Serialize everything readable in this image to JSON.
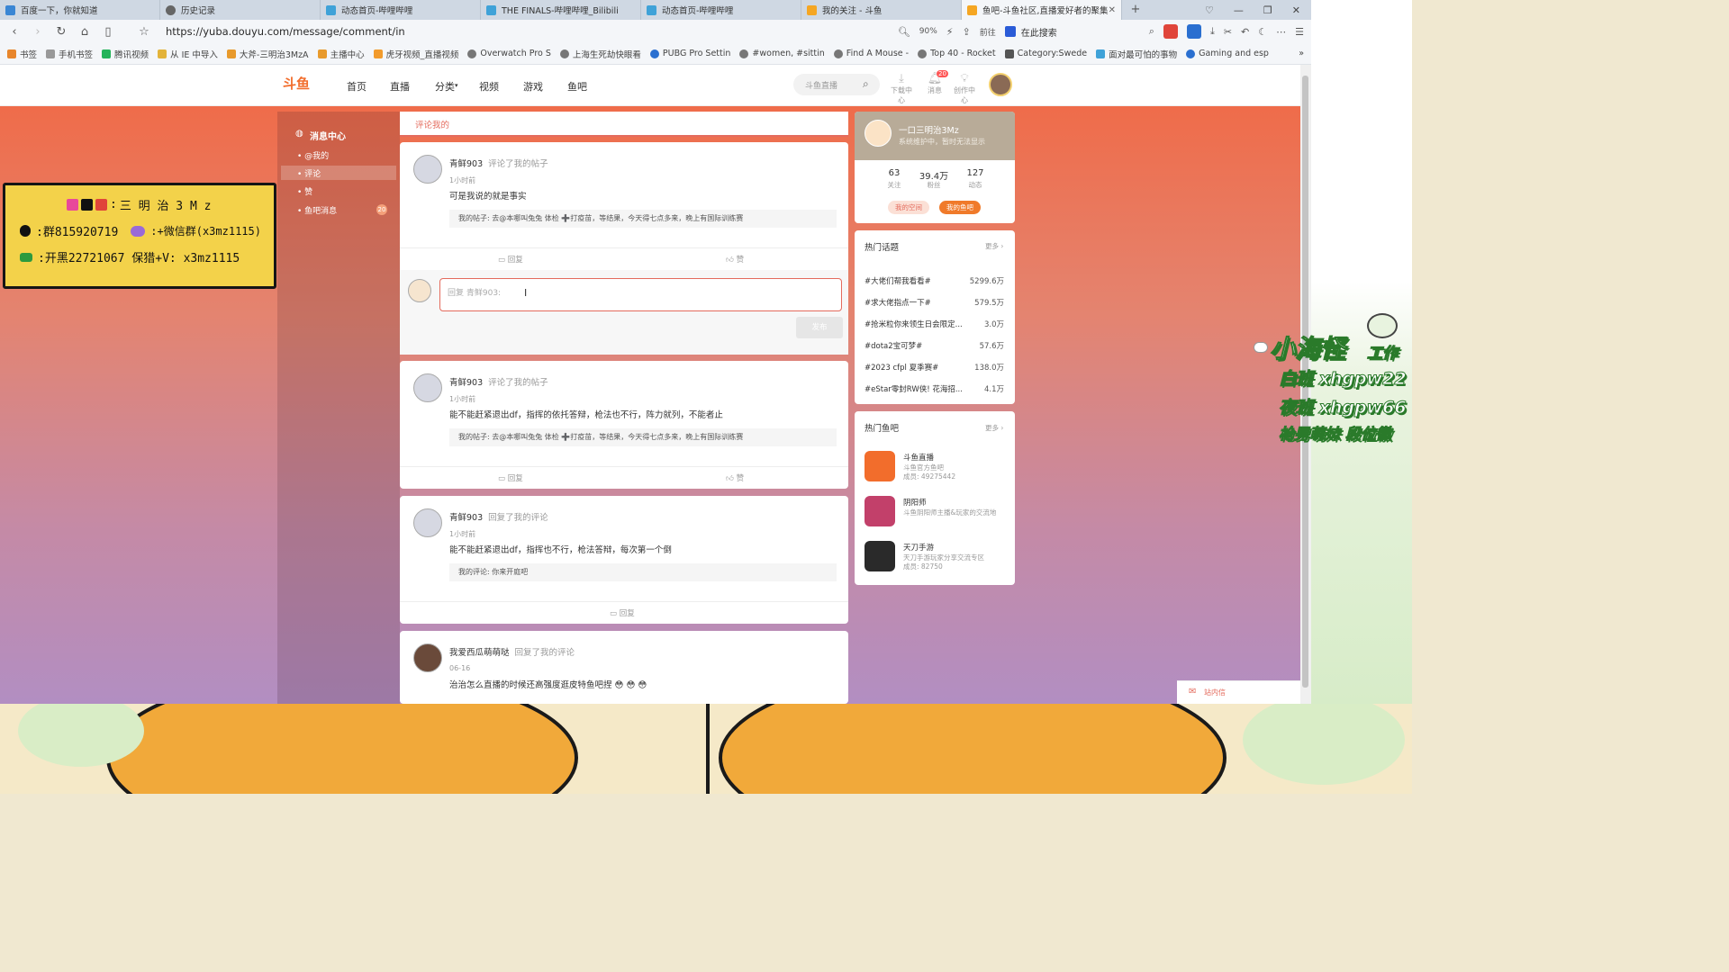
{
  "browser": {
    "tabs": [
      "百度一下，你就知道",
      "历史记录",
      "动态首页-哔哩哔哩",
      "THE FINALS-哔哩哔哩_Bilibili",
      "动态首页-哔哩哔哩",
      "我的关注 - 斗鱼",
      "鱼吧-斗鱼社区,直播爱好者的聚集"
    ],
    "new_tab": "+",
    "url": "https://yuba.douyu.com/message/comment/in",
    "zoom": "90%",
    "goto": "前往",
    "search_placeholder": "在此搜索",
    "bookmarks": [
      "书签",
      "手机书签",
      "腾讯视频",
      "从 IE 中导入",
      "大斧-三明治3MzA",
      "主播中心",
      "虎牙视频_直播视频",
      "Overwatch Pro S",
      "上海生死劫快眼看",
      "PUBG Pro Settin",
      "#women, #sittin",
      "Find A Mouse -",
      "Top 40 - Rocket",
      "Category:Swede",
      "面对最可怕的事物",
      "Gaming and esp"
    ]
  },
  "site": {
    "logo": "斗鱼",
    "nav": [
      "首页",
      "直播",
      "分类",
      "视频",
      "游戏",
      "鱼吧"
    ],
    "search_placeholder": "斗鱼直播",
    "header_icons": [
      "下载中心",
      "消息",
      "创作中心"
    ],
    "msg_badge": "20"
  },
  "leftnav": {
    "title": "消息中心",
    "items": [
      "@我的",
      "评论",
      "赞",
      "鱼吧消息"
    ],
    "badge": "20"
  },
  "main": {
    "tab": "评论我的",
    "comments": [
      {
        "user": "青鲜903",
        "action": "评论了我的帖子",
        "time": "1小时前",
        "text": "可是我说的就是事实",
        "quote_label": "我的帖子:",
        "quote": "去@本哪叫兔兔 体检 ➕打疫苗，等结果，今天得七点多来，晚上有国际训练赛",
        "reply": "回复",
        "like": "赞"
      },
      {
        "user": "青鲜903",
        "action": "评论了我的帖子",
        "time": "1小时前",
        "text": "能不能赶紧退出df，指挥的依托答辩，枪法也不行，阵力就列，不能者止",
        "quote_label": "我的帖子:",
        "quote": "去@本哪叫兔兔 体检 ➕打疫苗，等结果，今天得七点多来，晚上有国际训练赛",
        "reply": "回复",
        "like": "赞"
      },
      {
        "user": "青鲜903",
        "action": "回复了我的评论",
        "time": "1小时前",
        "text": "能不能赶紧退出df，指挥也不行，枪法答辩，每次第一个倒",
        "quote_label": "我的评论:",
        "quote": "你来开庭吧",
        "reply": "回复"
      },
      {
        "user": "我爱西瓜萌萌哒",
        "action": "回复了我的评论",
        "time": "06-16",
        "text": "治治怎么直播的时候还高强度逛皮特鱼吧捏 😳 😳 😳"
      }
    ],
    "reply_placeholder": "回复 青鲜903:",
    "send": "发布"
  },
  "profile": {
    "name": "一口三明治3Mz",
    "status": "系统维护中，暂时无法显示",
    "stats": [
      {
        "value": "63",
        "label": "关注"
      },
      {
        "value": "39.4万",
        "label": "粉丝"
      },
      {
        "value": "127",
        "label": "动态"
      }
    ],
    "btn_space": "我的空间",
    "btn_bar": "我的鱼吧"
  },
  "topics": {
    "title": "热门话题",
    "more": "更多 ›",
    "items": [
      {
        "name": "#大佬们帮我看看#",
        "count": "5299.6万"
      },
      {
        "name": "#求大佬指点一下#",
        "count": "579.5万"
      },
      {
        "name": "#抢米粒你来领生日会限定...",
        "count": "3.0万"
      },
      {
        "name": "#dota2宝可梦#",
        "count": "57.6万"
      },
      {
        "name": "#2023 cfpl 夏季赛#",
        "count": "138.0万"
      },
      {
        "name": "#eStar零封RW侠! 花海招...",
        "count": "4.1万"
      }
    ]
  },
  "hotbars": {
    "title": "热门鱼吧",
    "more": "更多 ›",
    "items": [
      {
        "name": "斗鱼直播",
        "desc": "斗鱼官方鱼吧",
        "members": "成员: 49275442",
        "color": "#f26d2c"
      },
      {
        "name": "阴阳师",
        "desc": "斗鱼阴阳师主播&玩家的交流地",
        "members": "",
        "color": "#c2406a"
      },
      {
        "name": "天刀手游",
        "desc": "天刀手游玩家分享交流专区",
        "members": "成员: 82750",
        "color": "#2a2a2a"
      }
    ]
  },
  "overlay_left": {
    "line1": "三 明 治 3 M z",
    "line2a": ":群815920719",
    "line2b": ":+微信群(x3mz1115)",
    "line3": ":开黑22721067  保猎+V: x3mz1115"
  },
  "overlay_right": {
    "line1": "小海怪",
    "line1b": "工作",
    "line2": "白班 xhgpw22",
    "line3": "夜班 xhgpw66",
    "line4": "枪男萌妹 段位徽"
  },
  "mail": "站内信"
}
